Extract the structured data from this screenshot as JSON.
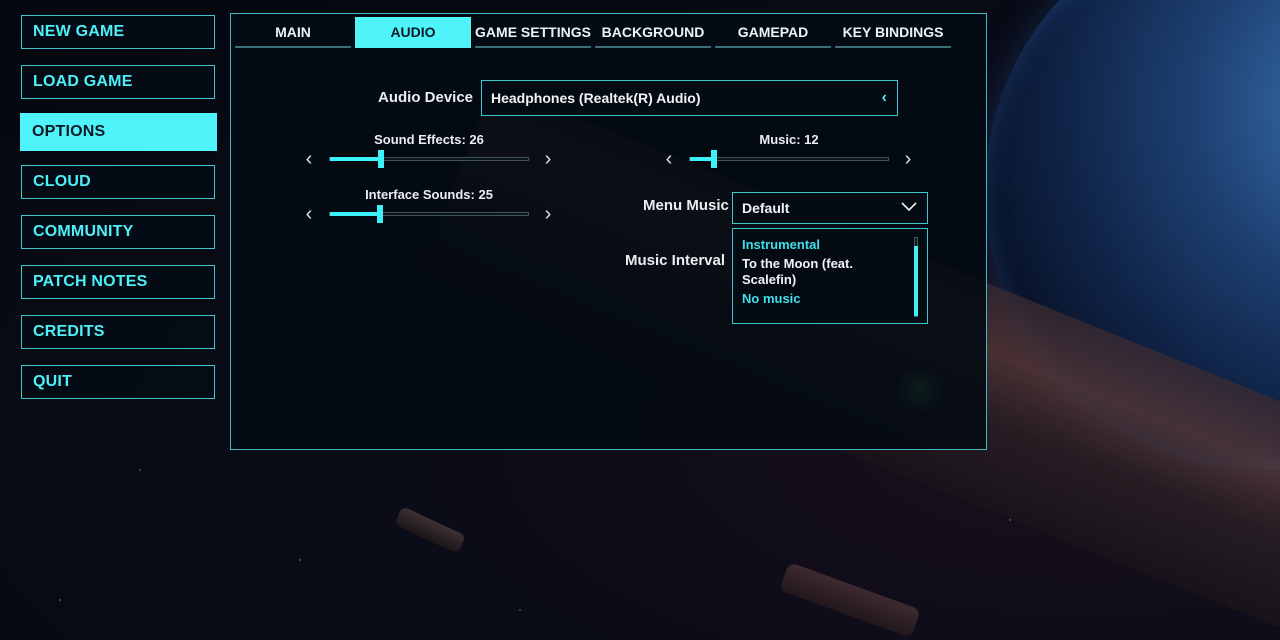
{
  "menu": {
    "items": [
      {
        "label": "NEW GAME",
        "active": false
      },
      {
        "label": "LOAD GAME",
        "active": false
      },
      {
        "label": "OPTIONS",
        "active": true
      },
      {
        "label": "CLOUD",
        "active": false
      },
      {
        "label": "COMMUNITY",
        "active": false
      },
      {
        "label": "PATCH NOTES",
        "active": false
      },
      {
        "label": "CREDITS",
        "active": false
      },
      {
        "label": "QUIT",
        "active": false
      }
    ]
  },
  "tabs": [
    {
      "label": "MAIN",
      "active": false
    },
    {
      "label": "AUDIO",
      "active": true
    },
    {
      "label": "GAME SETTINGS",
      "active": false
    },
    {
      "label": "BACKGROUND",
      "active": false
    },
    {
      "label": "GAMEPAD",
      "active": false
    },
    {
      "label": "KEY BINDINGS",
      "active": false
    }
  ],
  "audio": {
    "device_label": "Audio Device",
    "device_value": "Headphones (Realtek(R) Audio)",
    "sound_effects": {
      "title": "Sound Effects: 26",
      "value": 26,
      "max": 100
    },
    "interface_sounds": {
      "title": "Interface Sounds: 25",
      "value": 25,
      "max": 100
    },
    "music": {
      "title": "Music: 12",
      "value": 12,
      "max": 100
    },
    "menu_music_label": "Menu Music",
    "menu_music_value": "Default",
    "music_interval_label": "Music Interval",
    "music_interval_options": [
      {
        "label": "Instrumental",
        "highlight": true
      },
      {
        "label": "To the Moon (feat. Scalefin)",
        "highlight": false
      },
      {
        "label": "No music",
        "highlight": true
      }
    ]
  },
  "colors": {
    "accent": "#4ff4fb",
    "border": "#3fc6cf",
    "panel_bg": "#030a12"
  }
}
